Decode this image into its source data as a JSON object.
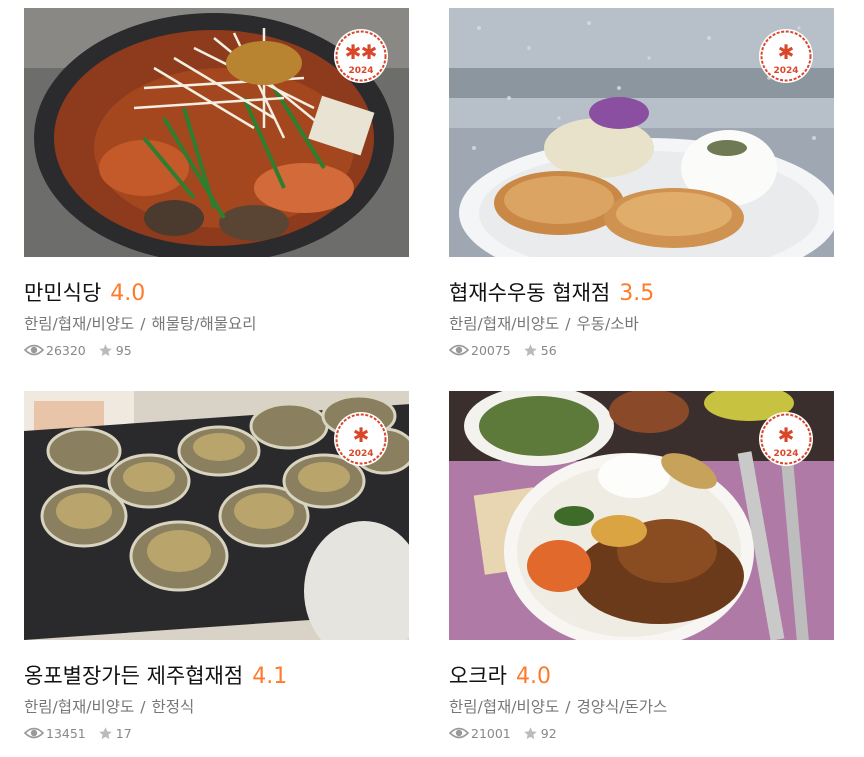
{
  "restaurants": [
    {
      "name": "만민식당",
      "score": "4.0",
      "area": "한림/협재/비양도",
      "category": "해물탕/해물요리",
      "views": "26320",
      "reviews": "95",
      "award_year": "2024",
      "award_level": 2
    },
    {
      "name": "협재수우동 협재점",
      "score": "3.5",
      "area": "한림/협재/비양도",
      "category": "우동/소바",
      "views": "20075",
      "reviews": "56",
      "award_year": "2024",
      "award_level": 1
    },
    {
      "name": "옹포별장가든 제주협재점",
      "score": "4.1",
      "area": "한림/협재/비양도",
      "category": "한정식",
      "views": "13451",
      "reviews": "17",
      "award_year": "2024",
      "award_level": 1
    },
    {
      "name": "오크라",
      "score": "4.0",
      "area": "한림/협재/비양도",
      "category": "경양식/돈가스",
      "views": "21001",
      "reviews": "92",
      "award_year": "2024",
      "award_level": 1
    }
  ],
  "separator": "/",
  "colors": {
    "score": "#ff7a2b",
    "badge": "#d9472b",
    "meta": "#777777"
  }
}
